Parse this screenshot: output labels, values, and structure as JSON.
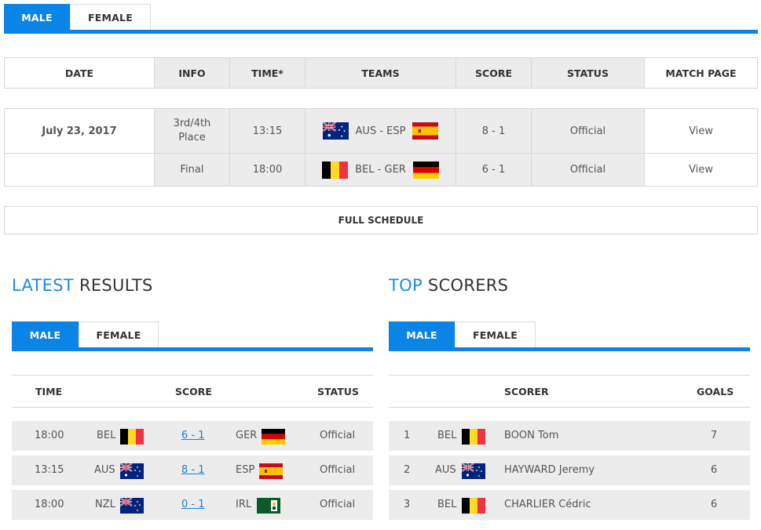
{
  "top_tabs": [
    "MALE",
    "FEMALE"
  ],
  "schedule": {
    "headers": [
      "DATE",
      "INFO",
      "TIME*",
      "TEAMS",
      "SCORE",
      "STATUS",
      "MATCH PAGE"
    ],
    "rows": [
      {
        "date": "July 23, 2017",
        "info_line1": "3rd/4th",
        "info_line2": "Place",
        "time": "13:15",
        "teams": "AUS - ESP",
        "flag_left": "australia-flag-icon",
        "flag_right": "spain-flag-icon",
        "score": "8 - 1",
        "status": "Official",
        "link": "View"
      },
      {
        "date": "",
        "info_line1": "Final",
        "info_line2": "",
        "time": "18:00",
        "teams": "BEL - GER",
        "flag_left": "belgium-flag-icon",
        "flag_right": "germany-flag-icon",
        "score": "6 - 1",
        "status": "Official",
        "link": "View"
      }
    ],
    "full_schedule": "FULL SCHEDULE"
  },
  "latest_results": {
    "title_highlight": "LATEST",
    "title_rest": " RESULTS",
    "tabs": [
      "MALE",
      "FEMALE"
    ],
    "headers": [
      "TIME",
      "SCORE",
      "STATUS"
    ],
    "rows": [
      {
        "time": "18:00",
        "home": "BEL",
        "score": "6 - 1",
        "away": "GER",
        "status": "Official"
      },
      {
        "time": "13:15",
        "home": "AUS",
        "score": "8 - 1",
        "away": "ESP",
        "status": "Official"
      },
      {
        "time": "18:00",
        "home": "NZL",
        "score": "0 - 1",
        "away": "IRL",
        "status": "Official"
      }
    ]
  },
  "top_scorers": {
    "title_highlight": "TOP",
    "title_rest": " SCORERS",
    "tabs": [
      "MALE",
      "FEMALE"
    ],
    "headers": [
      "SCORER",
      "GOALS"
    ],
    "rows": [
      {
        "rank": "1",
        "country": "BEL",
        "name": "BOON Tom",
        "goals": "7"
      },
      {
        "rank": "2",
        "country": "AUS",
        "name": "HAYWARD Jeremy",
        "goals": "6"
      },
      {
        "rank": "3",
        "country": "BEL",
        "name": "CHARLIER Cédric",
        "goals": "6"
      }
    ]
  },
  "colors": {
    "accent": "#0a84e6",
    "link": "#1a7fd4",
    "row_grey": "#ececec"
  }
}
